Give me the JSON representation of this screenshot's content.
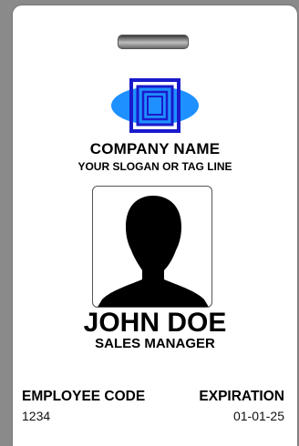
{
  "badge": {
    "company_name": "COMPANY NAME",
    "slogan": "YOUR SLOGAN OR TAG LINE",
    "person_name": "JOHN DOE",
    "job_title": "SALES MANAGER",
    "employee_code_label": "EMPLOYEE CODE",
    "employee_code_value": "1234",
    "expiration_label": "EXPIRATION",
    "expiration_value": "01-01-25"
  },
  "icons": {
    "logo": "nested-squares-logo-icon",
    "photo": "person-silhouette-icon",
    "slot": "lanyard-slot"
  },
  "colors": {
    "logo_ellipse": "#1e90ff",
    "logo_squares": "#1a1acc",
    "background": "#8a8a8a",
    "card": "#ffffff"
  }
}
